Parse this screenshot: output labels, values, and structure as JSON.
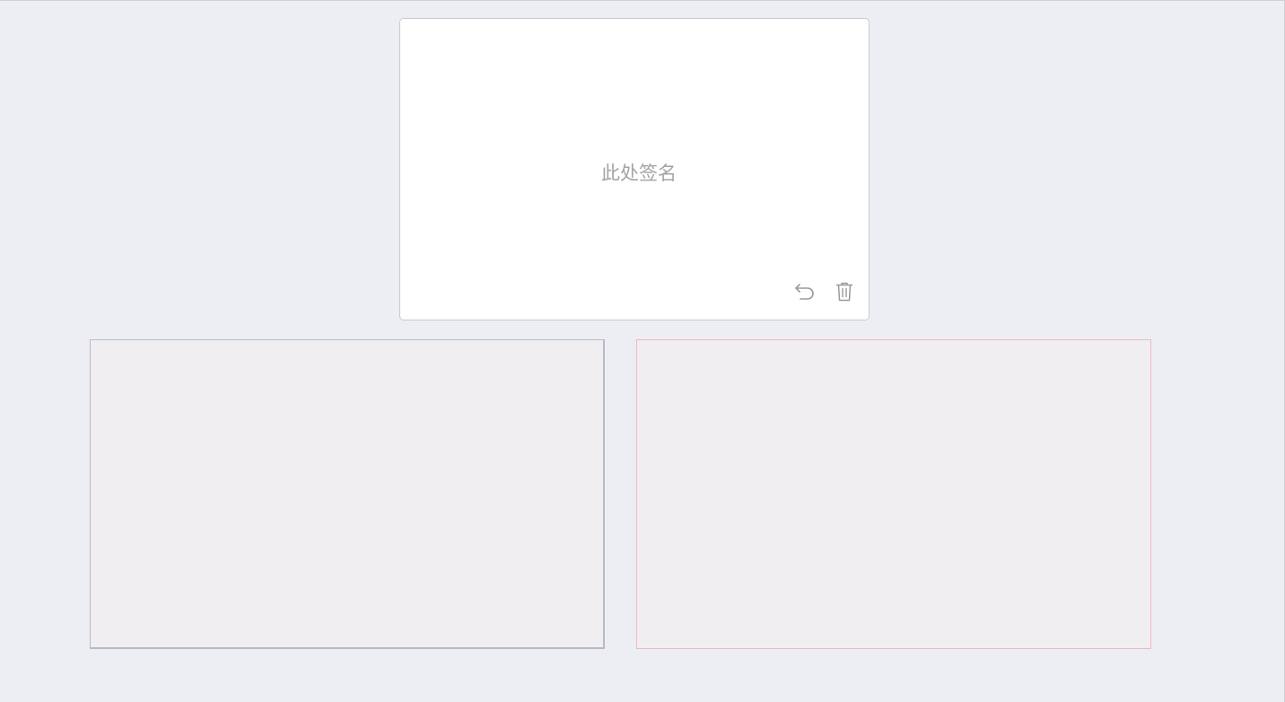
{
  "signature_pad": {
    "placeholder": "此处签名"
  },
  "toolbar": {
    "undo_icon": "undo-icon",
    "clear_icon": "trash-icon"
  },
  "colors": {
    "page_background": "#edeef3",
    "pad_background": "#ffffff",
    "pad_border": "#c8c9cf",
    "placeholder_text": "#a3a3a3",
    "icon": "#9a9a9a",
    "preview_background": "#f0eef0",
    "preview_left_border": "#b9bcc5",
    "preview_right_border": "#f0b7c1"
  }
}
